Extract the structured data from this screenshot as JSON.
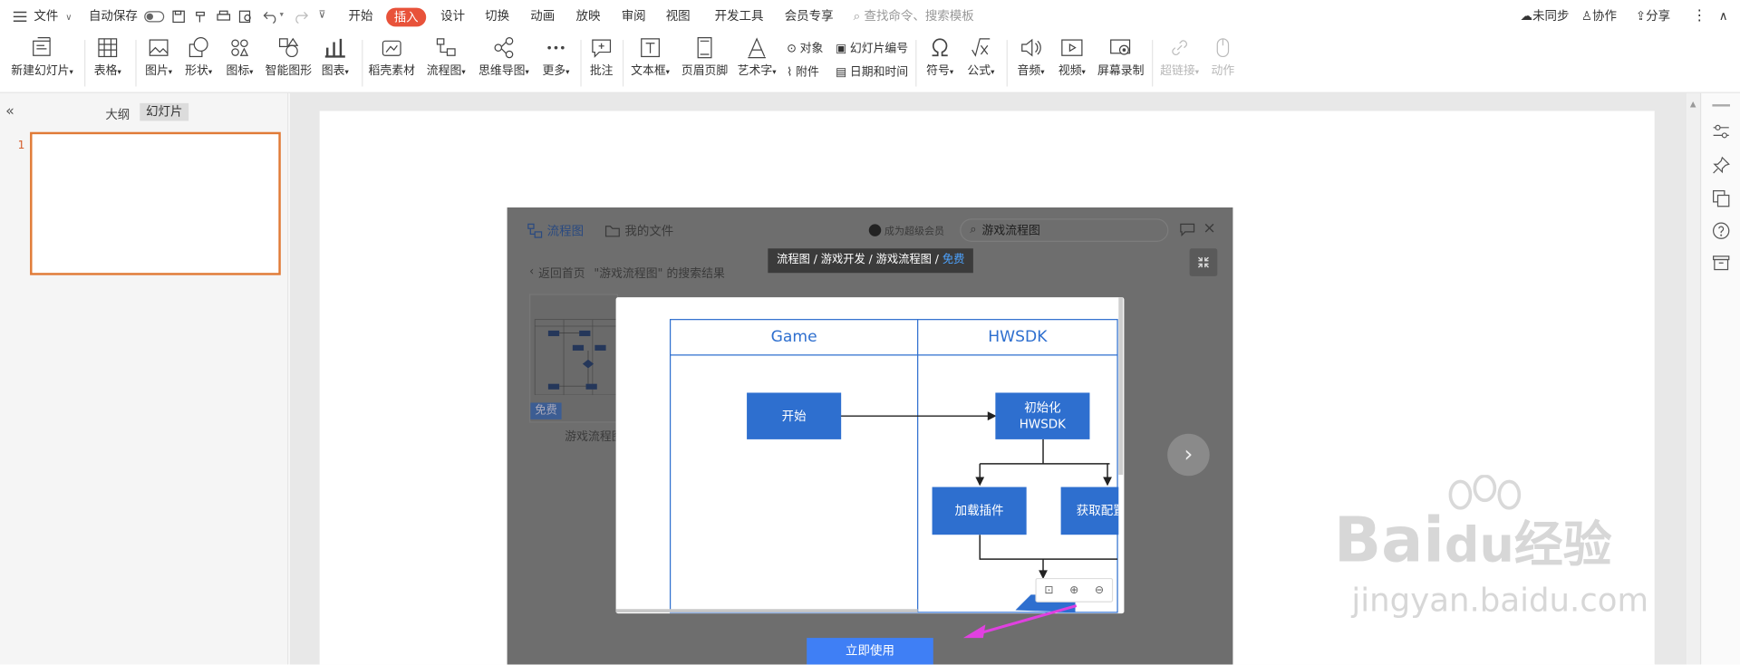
{
  "menubar": {
    "file": "文件",
    "autosave": "自动保存",
    "tabs": [
      "开始",
      "插入",
      "设计",
      "切换",
      "动画",
      "放映",
      "审阅",
      "视图",
      "开发工具",
      "会员专享"
    ],
    "search_placeholder": "查找命令、搜索模板",
    "right": {
      "sync": "未同步",
      "collab": "协作",
      "share": "分享"
    }
  },
  "ribbon": {
    "new_slide": "新建幻灯片",
    "table": "表格",
    "picture": "图片",
    "shape": "形状",
    "icon": "图标",
    "smart_art": "智能图形",
    "chart": "图表",
    "material": "稻壳素材",
    "flowchart": "流程图",
    "mindmap": "思维导图",
    "more": "更多",
    "comment": "批注",
    "textbox": "文本框",
    "header_footer": "页眉页脚",
    "wordart": "艺术字",
    "object": "对象",
    "attachment": "附件",
    "slide_number": "幻灯片编号",
    "datetime": "日期和时间",
    "symbol": "符号",
    "formula": "公式",
    "audio": "音频",
    "video": "视频",
    "screen_record": "屏幕录制",
    "hyperlink": "超链接",
    "action": "动作"
  },
  "leftpane": {
    "outline_tab": "大纲",
    "slides_tab": "幻灯片",
    "slide_number": "1"
  },
  "dialog": {
    "tab_flowchart": "流程图",
    "tab_myfiles": "我的文件",
    "vip_badge": "成为超级会员",
    "search_value": "游戏流程图",
    "back_link": "返回首页",
    "result_text": "\"游戏流程图\" 的搜索结果",
    "thumb_badge": "免费",
    "thumb_caption": "游戏流程图",
    "breadcrumb": "流程图 / 游戏开发 / 游戏流程图 / ",
    "breadcrumb_free": "免费",
    "use_button": "立即使用"
  },
  "flow": {
    "lane1": "Game",
    "lane2": "HWSDK",
    "start": "开始",
    "init_l1": "初始化",
    "init_l2": "HWSDK",
    "load_plugin": "加载插件",
    "get_config": "获取配置"
  },
  "watermark": {
    "line1_a": "Bai",
    "line1_b": "du",
    "line1_c": "经验",
    "line2": "jingyan.baidu.com"
  },
  "colors": {
    "accent": "#e8523a",
    "flow_blue": "#2e6fcf",
    "button_blue": "#3f7ff5",
    "arrow": "#e040e0"
  }
}
